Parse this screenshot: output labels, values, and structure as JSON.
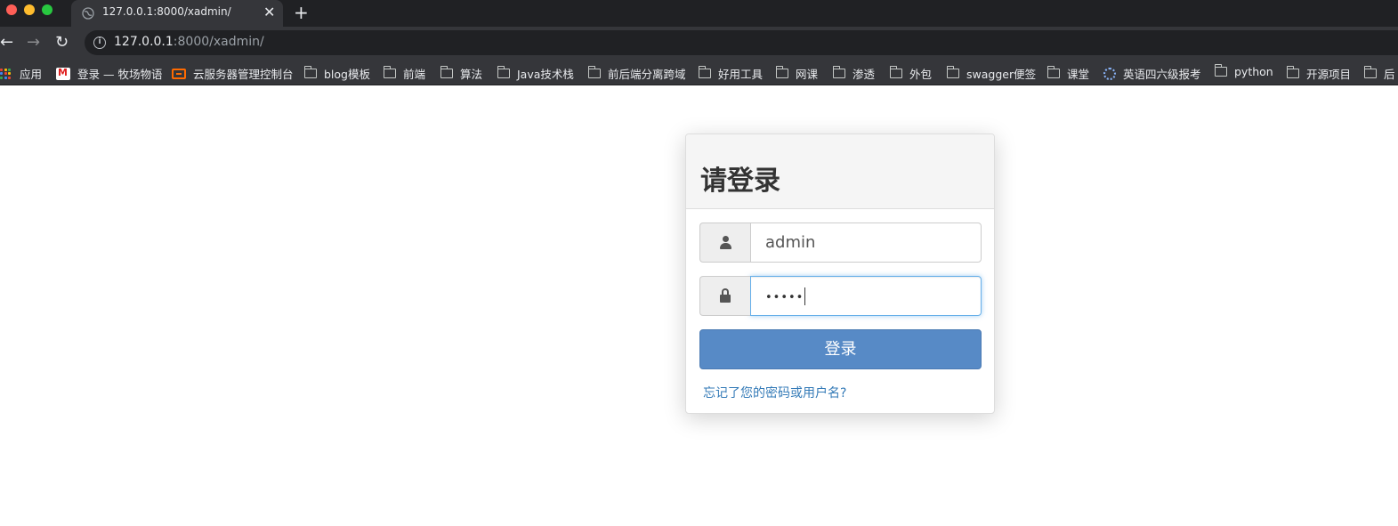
{
  "browser": {
    "tab": {
      "title": "127.0.0.1:8000/xadmin/",
      "close_glyph": "✕"
    },
    "new_tab_glyph": "+",
    "nav": {
      "back_glyph": "←",
      "forward_glyph": "→",
      "reload_glyph": "↻"
    },
    "address": {
      "host": "127.0.0.1",
      "rest": ":8000/xadmin/"
    },
    "bookmarks": [
      {
        "label": "应用",
        "icon": "apps-grid-icon"
      },
      {
        "label": "登录 — 牧场物语",
        "icon": "site-favicon-icon"
      },
      {
        "label": "云服务器管理控制台",
        "icon": "cloud-console-icon"
      },
      {
        "label": "blog模板",
        "icon": "folder-icon"
      },
      {
        "label": "前端",
        "icon": "folder-icon"
      },
      {
        "label": "算法",
        "icon": "folder-icon"
      },
      {
        "label": "Java技术栈",
        "icon": "folder-icon"
      },
      {
        "label": "前后端分离跨域",
        "icon": "folder-icon"
      },
      {
        "label": "好用工具",
        "icon": "folder-icon"
      },
      {
        "label": "网课",
        "icon": "folder-icon"
      },
      {
        "label": "渗透",
        "icon": "folder-icon"
      },
      {
        "label": "外包",
        "icon": "folder-icon"
      },
      {
        "label": "swagger便签",
        "icon": "folder-icon"
      },
      {
        "label": "课堂",
        "icon": "folder-icon"
      },
      {
        "label": "英语四六级报考",
        "icon": "gear-favicon-icon"
      },
      {
        "label": "python",
        "icon": "folder-icon"
      },
      {
        "label": "开源项目",
        "icon": "folder-icon"
      },
      {
        "label": "后",
        "icon": "folder-icon"
      }
    ]
  },
  "login": {
    "title": "请登录",
    "username": {
      "value": "admin",
      "icon": "user-icon"
    },
    "password": {
      "masked_value": "•••••",
      "icon": "lock-icon"
    },
    "submit_label": "登录",
    "forgot_link": "忘记了您的密码或用户名?"
  },
  "colors": {
    "chrome_dark": "#202124",
    "chrome_mid": "#35363a",
    "primary_button": "#578ac6",
    "link": "#337ab7",
    "focus_border": "#66afe9"
  }
}
